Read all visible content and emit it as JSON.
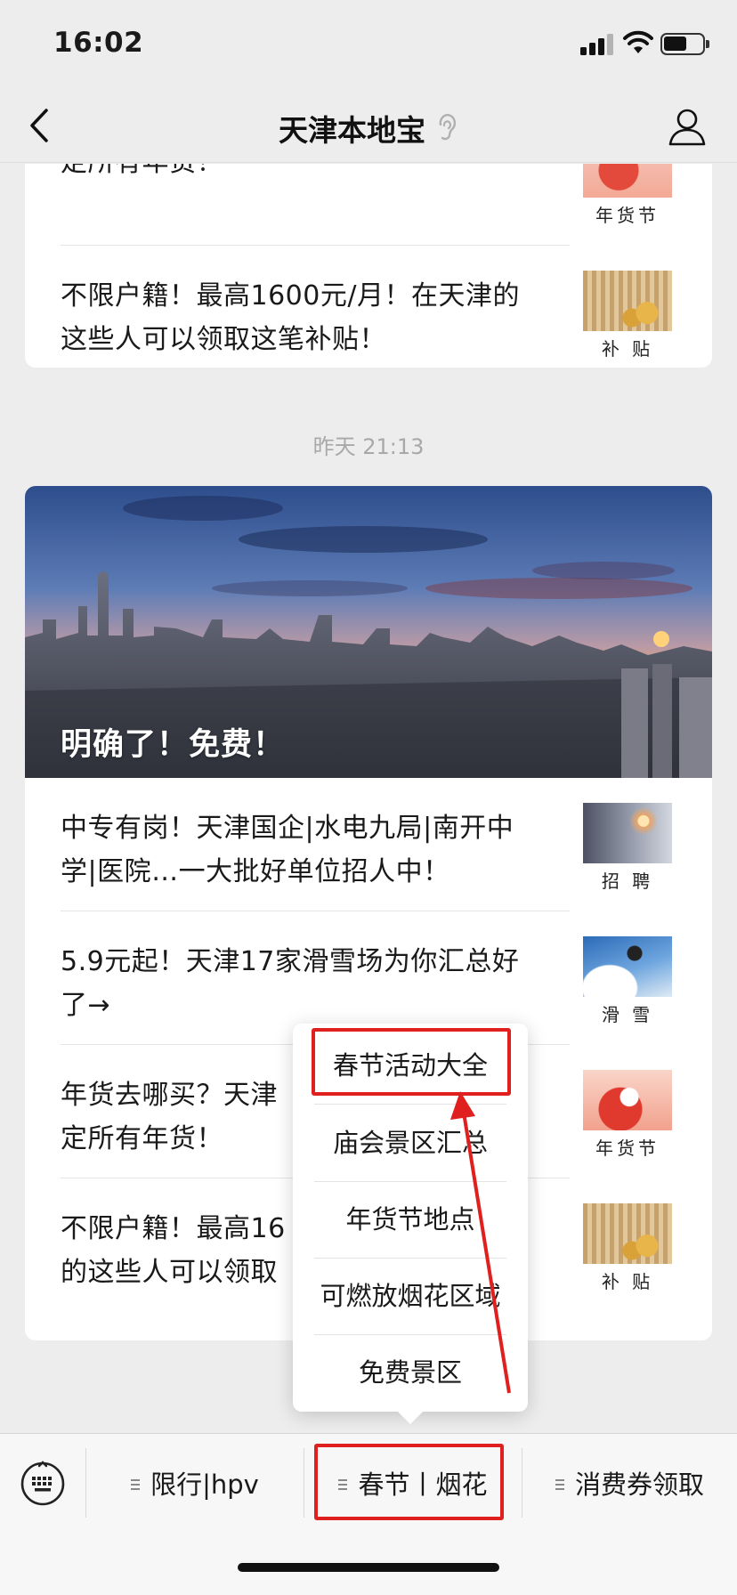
{
  "status_bar": {
    "time": "16:02"
  },
  "nav": {
    "title": "天津本地宝"
  },
  "card1": {
    "items": [
      {
        "text": "定所有年货！",
        "thumb_caption": "年货节",
        "thumb_kind": "new-year-festival"
      },
      {
        "text": "不限户籍！最高1600元/月！在天津的这些人可以领取这笔补贴！",
        "thumb_caption": "补 贴",
        "thumb_kind": "subsidy-coins"
      }
    ]
  },
  "timestamp": "昨天 21:13",
  "card2": {
    "hero": {
      "title": "明确了！免费！",
      "image": "tianjin-skyline-sunset"
    },
    "items": [
      {
        "text": "中专有岗！天津国企|水电九局|南开中学|医院…一大批好单位招人中！",
        "thumb_caption": "招 聘",
        "thumb_kind": "recruitment"
      },
      {
        "text": "5.9元起！天津17家滑雪场为你汇总好了→",
        "thumb_caption": "滑 雪",
        "thumb_kind": "skiing"
      },
      {
        "text": "年货去哪买？天津",
        "text2": "定所有年货！",
        "thumb_caption": "年货节",
        "thumb_kind": "new-year-festival"
      },
      {
        "text": "不限户籍！最高16",
        "text2": "的这些人可以领取",
        "thumb_caption": "补 贴",
        "thumb_kind": "subsidy-coins"
      }
    ]
  },
  "popup_menu": {
    "items": [
      "春节活动大全",
      "庙会景区汇总",
      "年货节地点",
      "可燃放烟花区域",
      "免费景区"
    ]
  },
  "menu_bar": {
    "buttons": [
      "限行|hpv",
      "春节丨烟花",
      "消费券领取"
    ]
  },
  "annotation": {
    "color": "#e0201e"
  }
}
